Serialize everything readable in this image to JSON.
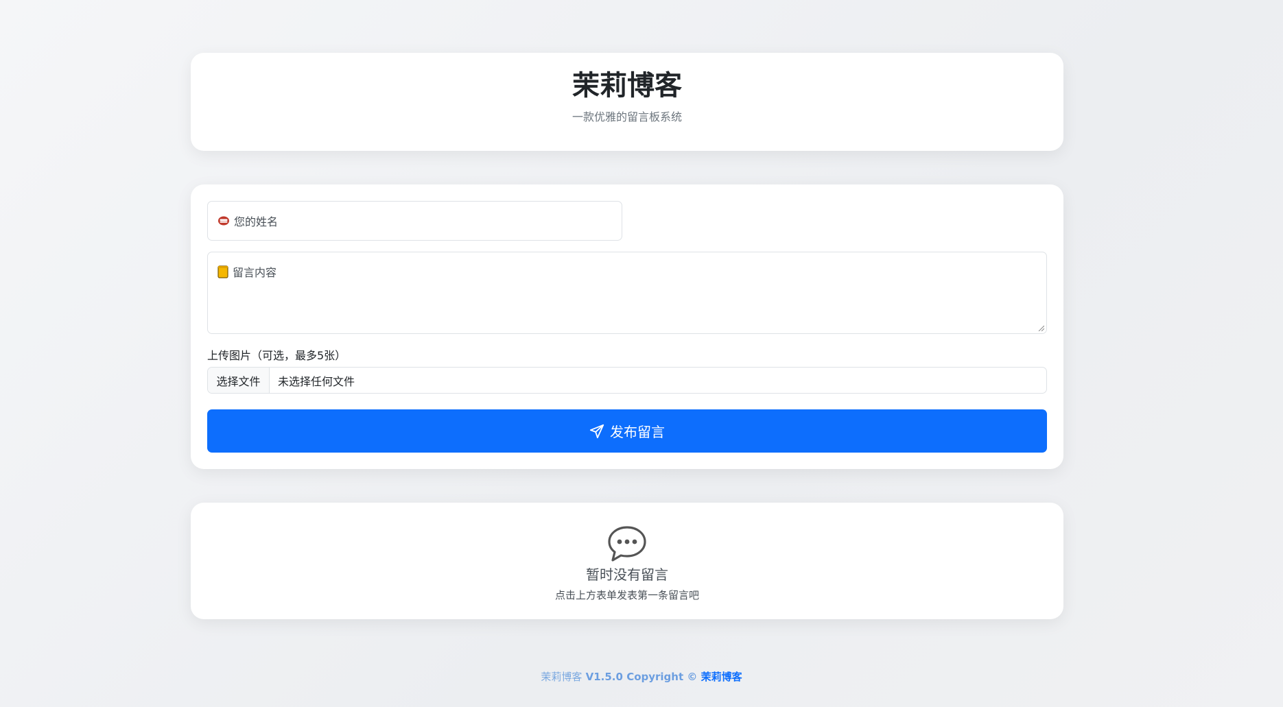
{
  "header": {
    "title": "茉莉博客",
    "subtitle": "一款优雅的留言板系统"
  },
  "form": {
    "name_placeholder": "您的姓名",
    "name_icon": "lips-emoji-icon",
    "content_placeholder": "留言内容",
    "content_icon": "notepad-emoji-icon",
    "upload_label": "上传图片（可选，最多5张）",
    "file_button": "选择文件",
    "file_status": "未选择任何文件",
    "submit_label": "发布留言",
    "submit_icon": "send-icon",
    "accent_color": "#0d6efd"
  },
  "empty_state": {
    "icon": "chat-bubble-icon",
    "title": "暂时没有留言",
    "subtitle": "点击上方表单发表第一条留言吧"
  },
  "footer": {
    "name": "茉莉博客",
    "version": "V1.5.0",
    "copyright": "Copyright ©",
    "link_text": "茉莉博客"
  }
}
